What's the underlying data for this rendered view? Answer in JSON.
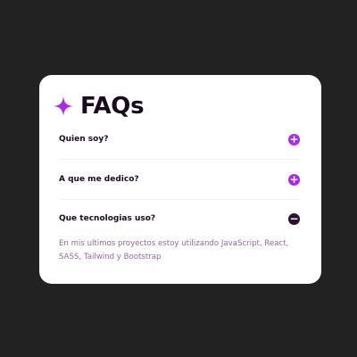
{
  "card": {
    "title": "FAQs",
    "icon": "star-icon",
    "colors": {
      "accent": "#ad28eb",
      "dark": "#2e0f34",
      "background": "#222222",
      "card": "#ffffff",
      "answer_text": "#8c6b92"
    }
  },
  "faqs": [
    {
      "question": "Quien soy?",
      "state": "collapsed",
      "toggle_icon": "plus-icon",
      "toggle_glyph": "+"
    },
    {
      "question": "A que me dedico?",
      "state": "collapsed",
      "toggle_icon": "plus-icon",
      "toggle_glyph": "+"
    },
    {
      "question": "Que tecnologias uso?",
      "state": "expanded",
      "toggle_icon": "minus-icon",
      "toggle_glyph": "−",
      "answer": "En mis ultimos proyectos estoy utilizando JavaScript, React, SASS, Tailwind y Bootstrap"
    }
  ]
}
